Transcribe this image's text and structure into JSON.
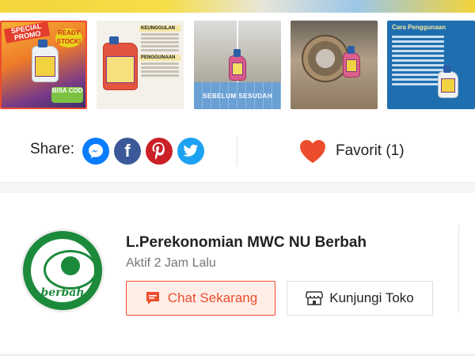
{
  "gallery": {
    "thumbnails": [
      {
        "id": "promo",
        "badge": "SPECIAL PROMO",
        "ready_badge": "READY STOCK!",
        "cod_badge": "BISA COD",
        "selected": true
      },
      {
        "id": "keunggulan",
        "heading_1": "KEUNGGULAN",
        "heading_2": "PENGGUNAAN",
        "selected": false
      },
      {
        "id": "sebelum-sesudah",
        "caption": "SEBELUM    SESUDAH",
        "selected": false
      },
      {
        "id": "basin",
        "selected": false
      },
      {
        "id": "cara-penggunaan",
        "title": "Cara Penggunaan",
        "selected": false
      }
    ]
  },
  "share": {
    "label": "Share:",
    "icons": [
      "messenger-icon",
      "facebook-icon",
      "pinterest-icon",
      "twitter-icon"
    ]
  },
  "favorite": {
    "label": "Favorit (1)",
    "icon": "heart-icon",
    "color": "#ee4d2d"
  },
  "shop": {
    "name": "L.Perekonomian MWC NU Berbah",
    "status": "Aktif 2 Jam Lalu",
    "logo_text": "berbah",
    "chat_button": "Chat Sekarang",
    "visit_button": "Kunjungi Toko"
  },
  "colors": {
    "accent": "#ee4d2d",
    "messenger": "#0a7cff",
    "facebook": "#3b5998",
    "pinterest": "#cb2027",
    "twitter": "#1da1f2",
    "logo_green": "#1c8a3b"
  }
}
